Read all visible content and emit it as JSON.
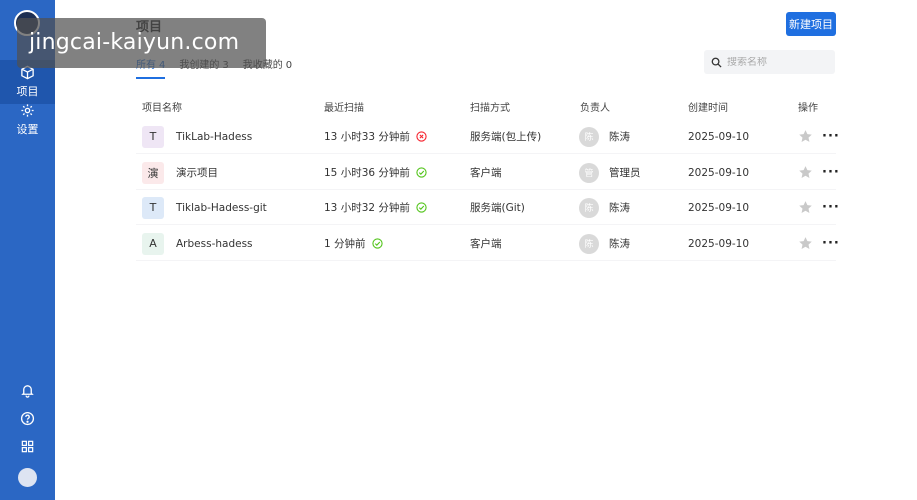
{
  "watermark": "jingcai-kaiyun.com",
  "sidebar": {
    "items": [
      {
        "label": "项目",
        "icon": "project-icon"
      },
      {
        "label": "设置",
        "icon": "gear-icon"
      }
    ],
    "bottom_icons": [
      "bell-icon",
      "help-icon",
      "apps-grid-icon",
      "user-avatar"
    ]
  },
  "header": {
    "title": "项目",
    "new_button": "新建项目"
  },
  "tabs": [
    {
      "label": "所有",
      "count": "4"
    },
    {
      "label": "我创建的",
      "count": "3"
    },
    {
      "label": "我收藏的",
      "count": "0"
    }
  ],
  "search": {
    "placeholder": "搜索名称"
  },
  "table": {
    "headers": [
      "项目名称",
      "最近扫描",
      "扫描方式",
      "负责人",
      "创建时间",
      "操作"
    ],
    "rows": [
      {
        "icon_char": "T",
        "icon_bg": "#efe6f5",
        "name": "TikLab-Hadess",
        "last_scan": "13 小时33 分钟前",
        "status": "error",
        "method": "服务端(包上传)",
        "owner_char": "陈",
        "owner": "陈涛",
        "created": "2025-09-10"
      },
      {
        "icon_char": "演",
        "icon_bg": "#fbe9ea",
        "name": "演示项目",
        "last_scan": "15 小时36 分钟前",
        "status": "success",
        "method": "客户端",
        "owner_char": "管",
        "owner": "管理员",
        "created": "2025-09-10"
      },
      {
        "icon_char": "T",
        "icon_bg": "#dde9f8",
        "name": "Tiklab-Hadess-git",
        "last_scan": "13 小时32 分钟前",
        "status": "success",
        "method": "服务端(Git)",
        "owner_char": "陈",
        "owner": "陈涛",
        "created": "2025-09-10"
      },
      {
        "icon_char": "A",
        "icon_bg": "#e8f4ee",
        "name": "Arbess-hadess",
        "last_scan": "1 分钟前",
        "status": "success",
        "method": "客户端",
        "owner_char": "陈",
        "owner": "陈涛",
        "created": "2025-09-10"
      }
    ]
  },
  "colors": {
    "sidebar": "#2b67c4",
    "primary": "#1f6fe0",
    "success": "#52c41a",
    "error": "#f5222d"
  }
}
